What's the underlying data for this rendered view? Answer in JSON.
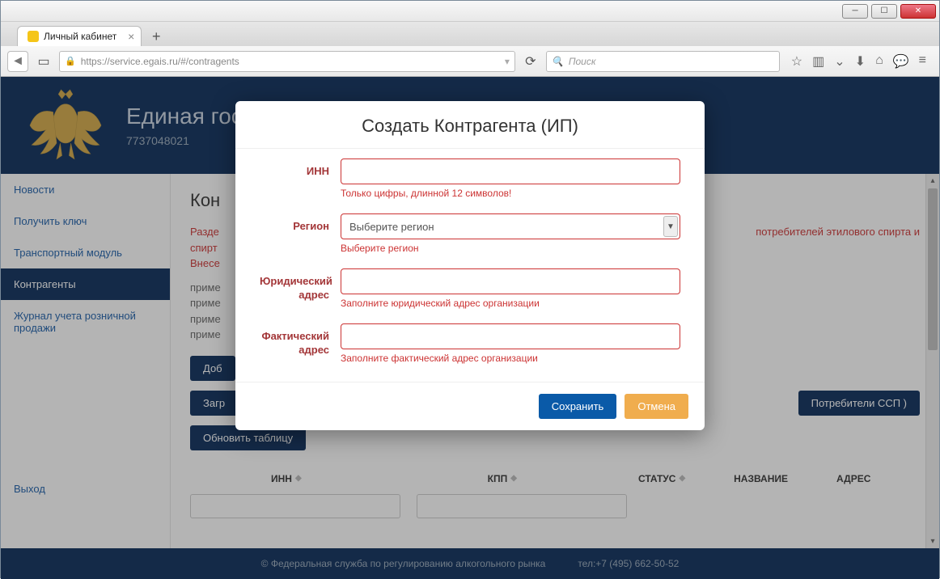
{
  "browser": {
    "tab_title": "Личный кабинет",
    "url": "https://service.egais.ru/#/contragents",
    "search_placeholder": "Поиск"
  },
  "header": {
    "title": "Единая гос",
    "inn": "7737048021"
  },
  "sidebar": {
    "items": [
      {
        "label": "Новости"
      },
      {
        "label": "Получить ключ"
      },
      {
        "label": "Транспортный модуль"
      },
      {
        "label": "Контрагенты"
      },
      {
        "label": "Журнал учета розничной продажи"
      },
      {
        "label": "Выход"
      }
    ]
  },
  "main": {
    "heading": "Кон",
    "red_note_1": "Разде",
    "red_note_2": "потребителей этилового спирта и",
    "red_note_3": "спирт",
    "red_note_4": "Внесе",
    "gray_lines": [
      "приме",
      "приме",
      "приме",
      "приме"
    ],
    "buttons": {
      "add": "Доб",
      "load1": "Загр",
      "load2_suffix": "Потребители ССП )",
      "refresh": "Обновить таблицу"
    },
    "table": {
      "columns": [
        "ИНН",
        "КПП",
        "СТАТУС",
        "НАЗВАНИЕ",
        "АДРЕС"
      ]
    }
  },
  "footer": {
    "copyright": "© Федеральная служба по регулированию алкогольного рынка",
    "tel": "тел:+7 (495) 662-50-52"
  },
  "modal": {
    "title": "Создать Контрагента (ИП)",
    "fields": {
      "inn": {
        "label": "ИНН",
        "error": "Только цифры, длинной 12 символов!"
      },
      "region": {
        "label": "Регион",
        "placeholder": "Выберите регион",
        "error": "Выберите регион"
      },
      "legal_addr": {
        "label": "Юридический адрес",
        "error": "Заполните юридический адрес организации"
      },
      "actual_addr": {
        "label": "Фактический адрес",
        "error": "Заполните фактический адрес организации"
      }
    },
    "save": "Сохранить",
    "cancel": "Отмена"
  }
}
